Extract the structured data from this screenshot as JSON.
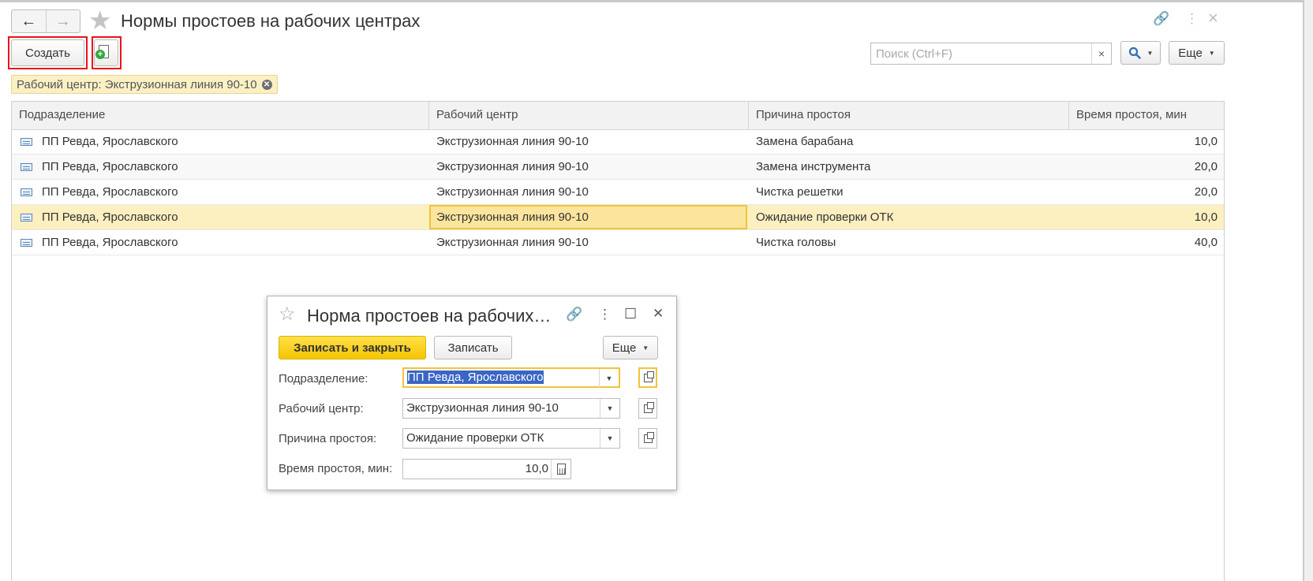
{
  "window": {
    "title": "Нормы простоев на рабочих центрах",
    "back_icon": "←",
    "forward_icon": "→",
    "favorite_icon": "★",
    "link_icon": "🔗",
    "menu_icon": "⋮",
    "close_icon": "×"
  },
  "toolbar": {
    "create_label": "Создать",
    "search_placeholder": "Поиск (Ctrl+F)",
    "search_clear": "×",
    "more_label": "Еще"
  },
  "filter": {
    "label": "Рабочий центр: Экструзионная линия 90-10"
  },
  "table": {
    "columns": [
      "Подразделение",
      "Рабочий центр",
      "Причина простоя",
      "Время простоя, мин"
    ],
    "rows": [
      [
        "ПП Ревда, Ярославского",
        "Экструзионная линия 90-10",
        "Замена барабана",
        "10,0"
      ],
      [
        "ПП Ревда, Ярославского",
        "Экструзионная линия 90-10",
        "Замена инструмента",
        "20,0"
      ],
      [
        "ПП Ревда, Ярославского",
        "Экструзионная линия 90-10",
        "Чистка решетки",
        "20,0"
      ],
      [
        "ПП Ревда, Ярославского",
        "Экструзионная линия 90-10",
        "Ожидание проверки ОТК",
        "10,0"
      ],
      [
        "ПП Ревда, Ярославского",
        "Экструзионная линия 90-10",
        "Чистка головы",
        "40,0"
      ]
    ],
    "selected_row": 3
  },
  "dialog": {
    "title": "Норма простоев на рабочих…",
    "star_icon": "☆",
    "link_icon": "🔗",
    "menu_icon": "⋮",
    "maximize_icon": "☐",
    "close_icon": "✕",
    "save_close_label": "Записать и закрыть",
    "save_label": "Записать",
    "more_label": "Еще",
    "fields": {
      "department_label": "Подразделение:",
      "department_value": "ПП Ревда, Ярославского",
      "workcenter_label": "Рабочий центр:",
      "workcenter_value": "Экструзионная линия 90-10",
      "reason_label": "Причина простоя:",
      "reason_value": "Ожидание проверки ОТК",
      "time_label": "Время простоя, мин:",
      "time_value": "10,0"
    }
  },
  "colors": {
    "highlight_red": "#e8141a",
    "selected_row": "#fcefc0",
    "focus_border": "#f0c43a",
    "primary_button": "#f5c500"
  }
}
